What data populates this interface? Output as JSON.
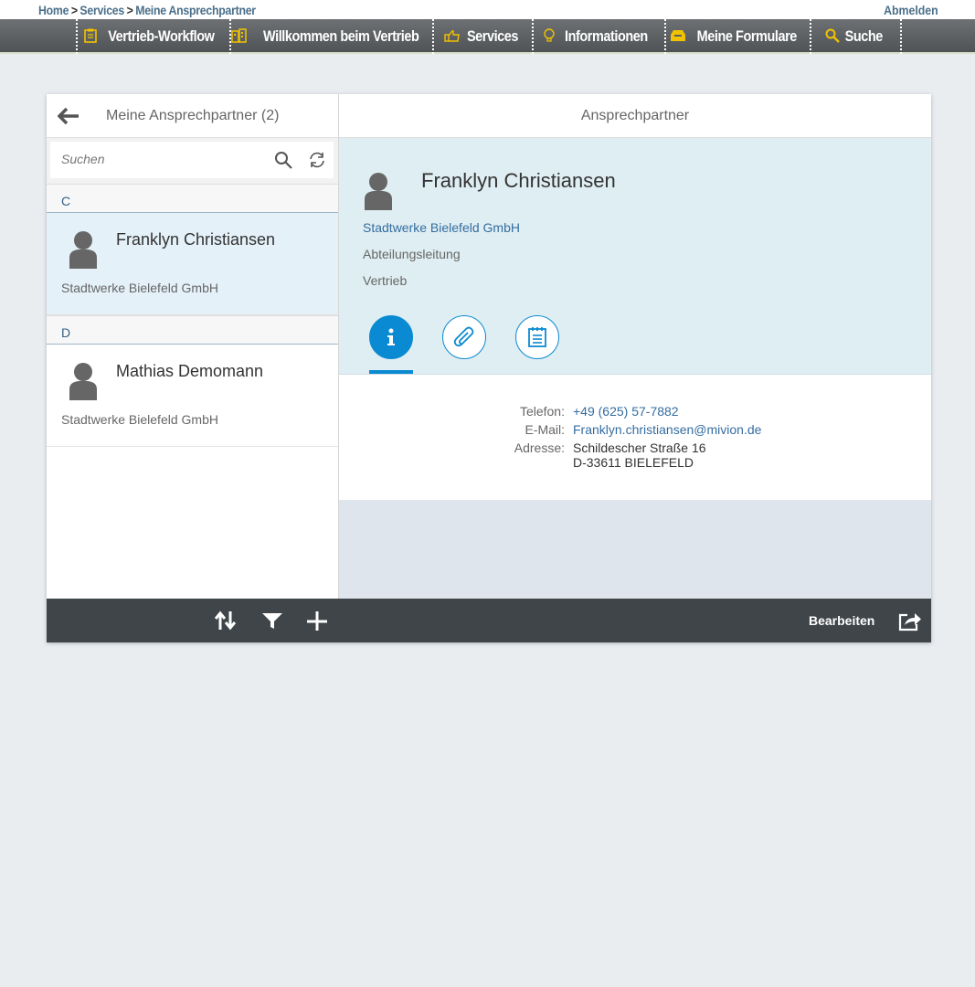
{
  "breadcrumb": {
    "items": [
      "Home",
      "Services",
      "Meine Ansprechpartner"
    ],
    "separator": ">"
  },
  "logout_label": "Abmelden",
  "nav": {
    "items": [
      {
        "label": "Vertrieb-Workflow",
        "icon": "clipboard-icon"
      },
      {
        "label": "Willkommen beim Vertrieb",
        "icon": "building-icon"
      },
      {
        "label": "Services",
        "icon": "thumbs-up-icon"
      },
      {
        "label": "Informationen",
        "icon": "lightbulb-icon"
      },
      {
        "label": "Meine Formulare",
        "icon": "inbox-icon"
      },
      {
        "label": "Suche",
        "icon": "search-icon"
      }
    ],
    "icon_color": "#f2c200"
  },
  "master": {
    "title": "Meine Ansprechpartner (2)",
    "search_placeholder": "Suchen",
    "groups": [
      {
        "letter": "C",
        "items": [
          {
            "name": "Franklyn Christiansen",
            "company": "Stadtwerke Bielefeld GmbH",
            "selected": true
          }
        ]
      },
      {
        "letter": "D",
        "items": [
          {
            "name": "Mathias Demomann",
            "company": "Stadtwerke Bielefeld GmbH",
            "selected": false
          }
        ]
      }
    ]
  },
  "detail": {
    "title": "Ansprechpartner",
    "name": "Franklyn Christiansen",
    "company": "Stadtwerke Bielefeld GmbH",
    "department": "Abteilungsleitung",
    "unit": "Vertrieb",
    "tabs": [
      "info-icon",
      "attachment-icon",
      "notes-icon"
    ],
    "active_tab": 0,
    "info": {
      "phone_label": "Telefon:",
      "phone": "+49 (625) 57-7882",
      "email_label": "E-Mail:",
      "email": "Franklyn.christiansen@mivion.de",
      "address_label": "Adresse:",
      "address_line1": "Schildescher Straße 16",
      "address_line2": "D-33611 BIELEFELD"
    }
  },
  "footer": {
    "edit_label": "Bearbeiten",
    "icons": [
      "sort-icon",
      "filter-icon",
      "add-icon",
      "share-icon"
    ]
  },
  "colors": {
    "accent": "#0a8ad2",
    "link": "#346da1",
    "footer_bg": "#3f4549",
    "selected_bg": "#e5f1f9"
  }
}
